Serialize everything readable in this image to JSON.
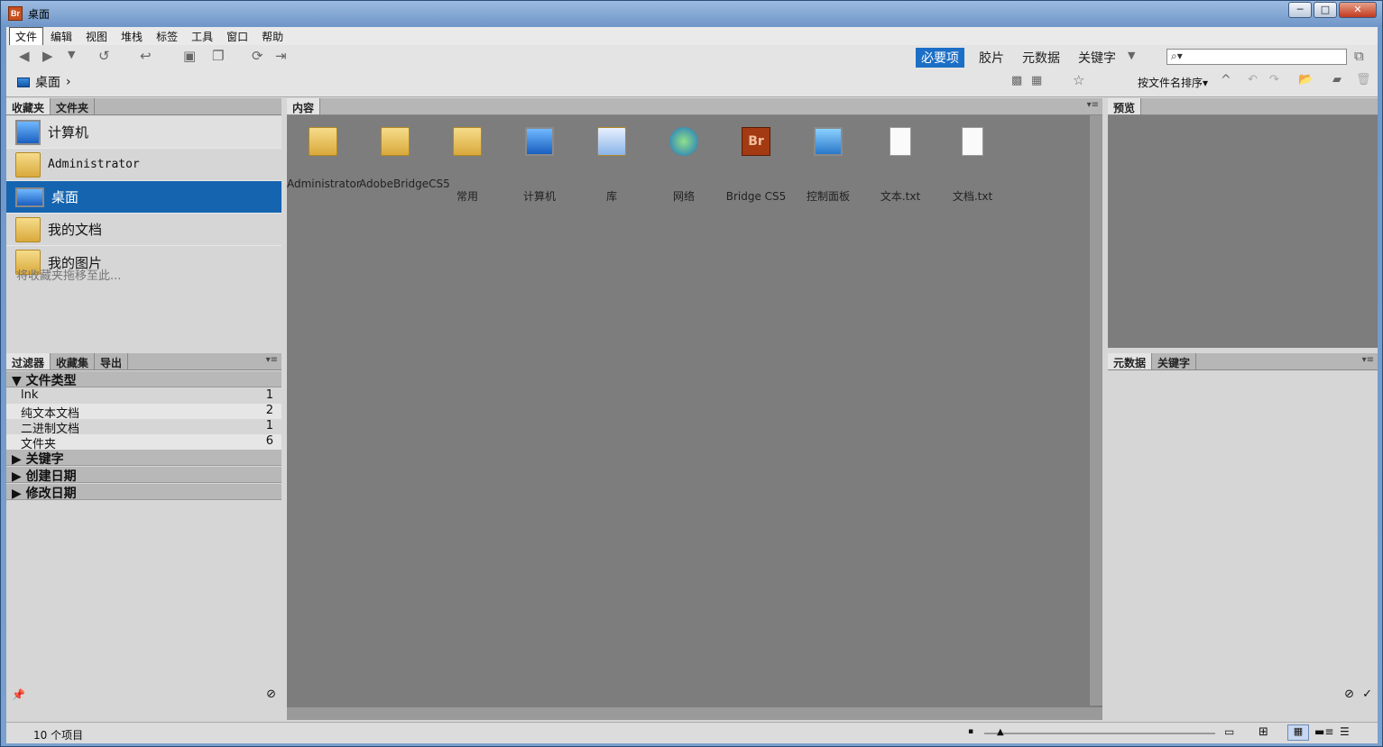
{
  "window": {
    "title": "桌面",
    "app_icon": "Br",
    "btn_min": "─",
    "btn_max": "□",
    "btn_close": "✕"
  },
  "menu": [
    "文件",
    "编辑",
    "视图",
    "堆栈",
    "标签",
    "工具",
    "窗口",
    "帮助"
  ],
  "workspaces": [
    "必要项",
    "胶片",
    "元数据",
    "关键字"
  ],
  "search": {
    "placeholder": "⌕▾"
  },
  "breadcrumb": {
    "label": "桌面",
    "chevron": "›"
  },
  "sort": {
    "label": "按文件名排序",
    "arrow": "▾",
    "dir": "^"
  },
  "left_panel": {
    "tabs": [
      "收藏夹",
      "文件夹"
    ],
    "favorites": [
      {
        "label": "计算机",
        "icon": "computer-icon"
      },
      {
        "label": "Administrator",
        "icon": "folder-icon"
      },
      {
        "label": "桌面",
        "icon": "desktop-icon"
      },
      {
        "label": "我的文档",
        "icon": "documents-folder-icon"
      },
      {
        "label": "我的图片",
        "icon": "pictures-folder-icon"
      }
    ],
    "hint": "将收藏夹拖移至此..."
  },
  "filter_panel": {
    "tabs": [
      "过滤器",
      "收藏集",
      "导出"
    ],
    "sections": [
      {
        "label": "文件类型",
        "expanded": true,
        "rows": [
          {
            "label": "lnk",
            "count": "1"
          },
          {
            "label": "纯文本文档",
            "count": "2"
          },
          {
            "label": "二进制文档",
            "count": "1"
          },
          {
            "label": "文件夹",
            "count": "6"
          }
        ]
      },
      {
        "label": "关键字",
        "expanded": false
      },
      {
        "label": "创建日期",
        "expanded": false
      },
      {
        "label": "修改日期",
        "expanded": false
      }
    ]
  },
  "content_panel": {
    "tab": "内容",
    "items": [
      {
        "name": "Administrator",
        "icon": "user-folder-icon"
      },
      {
        "name": "AdobeBridgeCS5",
        "icon": "folder-icon"
      },
      {
        "name": "常用",
        "icon": "folder-icon"
      },
      {
        "name": "计算机",
        "icon": "computer-icon"
      },
      {
        "name": "库",
        "icon": "library-icon"
      },
      {
        "name": "网络",
        "icon": "network-icon"
      },
      {
        "name": "Bridge CS5",
        "icon": "bridge-app-icon",
        "badge": "Br"
      },
      {
        "name": "控制面板",
        "icon": "control-panel-icon"
      },
      {
        "name": "文本.txt",
        "icon": "text-file-icon"
      },
      {
        "name": "文档.txt",
        "icon": "text-file-icon"
      }
    ]
  },
  "right_panel": {
    "preview_tab": "预览",
    "meta_tabs": [
      "元数据",
      "关键字"
    ]
  },
  "status": {
    "count": "10 个项目"
  },
  "colors": {
    "selection": "#1564b0",
    "content_bg": "#7d7d7d",
    "workspace_active": "#1c6fc6"
  }
}
